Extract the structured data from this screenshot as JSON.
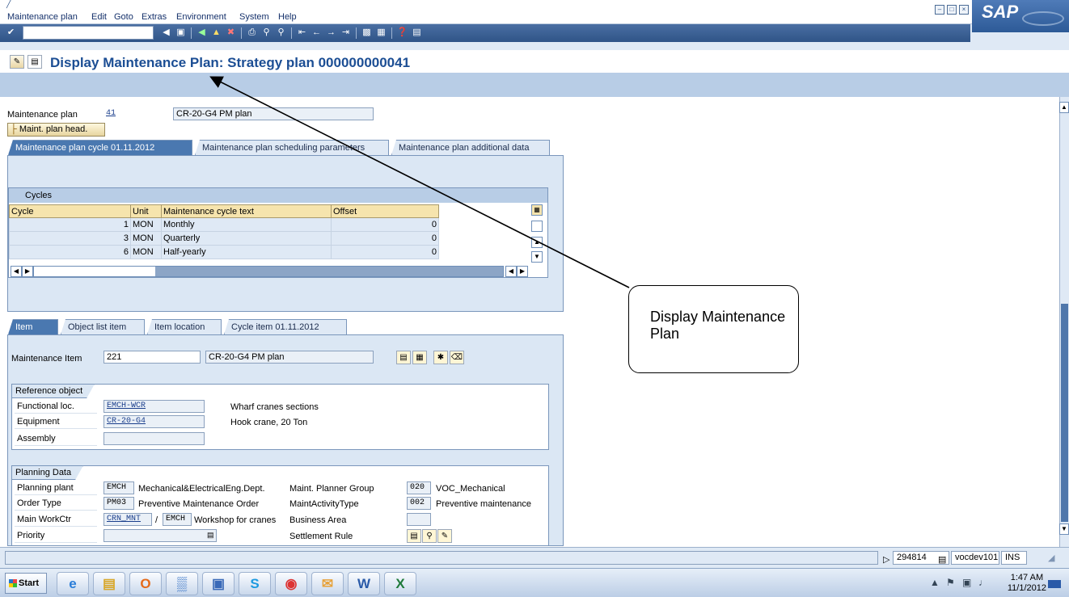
{
  "menu": {
    "items": [
      "Maintenance plan",
      "Edit",
      "Goto",
      "Extras",
      "Environment",
      "System",
      "Help"
    ],
    "logo": "SAP"
  },
  "toolbar": {
    "command_value": "",
    "icons": [
      "enter-icon",
      "dropdown-icon",
      "back-history-icon",
      "save-icon",
      "back-icon",
      "exit-icon",
      "cancel-icon",
      "print-icon",
      "find-icon",
      "find-next-icon",
      "first-page-icon",
      "previous-page-icon",
      "next-page-icon",
      "last-page-icon",
      "new-session-icon",
      "shortcut-icon",
      "help-icon",
      "layout-icon"
    ]
  },
  "title": "Display Maintenance Plan: Strategy plan 000000000041",
  "header": {
    "plan_label": "Maintenance plan",
    "plan_number": "41",
    "plan_text": "CR-20-G4 PM plan",
    "head_button": "Maint. plan head."
  },
  "tabs_top": [
    "Maintenance plan cycle 01.11.2012",
    "Maintenance plan scheduling parameters",
    "Maintenance plan additional data"
  ],
  "cycles": {
    "title": "Cycles",
    "columns": [
      "Cycle",
      "Unit",
      "Maintenance cycle text",
      "Offset"
    ],
    "rows": [
      {
        "cycle": "1",
        "unit": "MON",
        "text": "Monthly",
        "offset": "0"
      },
      {
        "cycle": "3",
        "unit": "MON",
        "text": "Quarterly",
        "offset": "0"
      },
      {
        "cycle": "6",
        "unit": "MON",
        "text": "Half-yearly",
        "offset": "0"
      }
    ]
  },
  "tabs_bottom": [
    "Item",
    "Object list item",
    "Item location",
    "Cycle item 01.11.2012"
  ],
  "item": {
    "label": "Maintenance Item",
    "number": "221",
    "text": "CR-20-G4 PM plan"
  },
  "reference": {
    "title": "Reference object",
    "func_loc_label": "Functional loc.",
    "func_loc_value": "EMCH-WCR",
    "func_loc_text": "Wharf cranes sections",
    "equipment_label": "Equipment",
    "equipment_value": "CR-20-G4",
    "equipment_text": "Hook crane, 20 Ton",
    "assembly_label": "Assembly",
    "assembly_value": ""
  },
  "planning": {
    "title": "Planning Data",
    "plant_label": "Planning plant",
    "plant_value": "EMCH",
    "plant_text": "Mechanical&ElectricalEng.Dept.",
    "planner_group_label": "Maint. Planner Group",
    "planner_group_value": "020",
    "planner_group_text": "VOC_Mechanical",
    "order_type_label": "Order Type",
    "order_type_value": "PM03",
    "order_type_text": "Preventive Maintenance Order",
    "activity_type_label": "MaintActivityType",
    "activity_type_value": "002",
    "activity_type_text": "Preventive maintenance",
    "workctr_label": "Main WorkCtr",
    "workctr_value": "CRN_MNT",
    "workctr_sep": "/",
    "workctr_plant": "EMCH",
    "workctr_text": "Workshop for cranes",
    "business_area_label": "Business Area",
    "business_area_value": "",
    "priority_label": "Priority",
    "priority_value": "",
    "settlement_label": "Settlement Rule"
  },
  "status": {
    "session": "294814",
    "server": "vocdev101",
    "mode": "INS"
  },
  "taskbar": {
    "start": "Start",
    "apps": [
      "internet-explorer-icon",
      "file-explorer-icon",
      "outlook-icon",
      "sap-logon-icon",
      "remote-desktop-icon",
      "skype-icon",
      "chrome-icon",
      "mail-icon",
      "word-icon",
      "excel-icon"
    ],
    "time": "1:47 AM",
    "date": "11/1/2012"
  },
  "callout": {
    "text": "Display Maintenance Plan"
  }
}
